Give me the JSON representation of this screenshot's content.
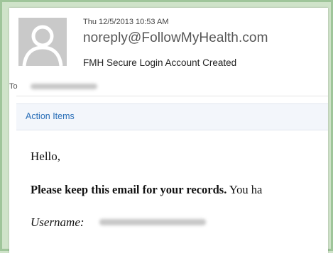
{
  "email": {
    "datetime": "Thu 12/5/2013 10:53 AM",
    "sender": "noreply@FollowMyHealth.com",
    "subject": "FMH Secure Login Account Created",
    "to_label": "To",
    "action_items_label": "Action Items",
    "body": {
      "greeting": "Hello,",
      "keep_bold": "Please keep this email for your records.",
      "keep_rest": " You ha",
      "username_label": "Username:"
    }
  },
  "icons": {
    "avatar": "person-placeholder-icon"
  },
  "colors": {
    "frame_bg": "#cfe3c9",
    "frame_border": "#9fc59a",
    "link_blue": "#2a6fb8",
    "action_bar_bg": "#f3f6fb"
  }
}
